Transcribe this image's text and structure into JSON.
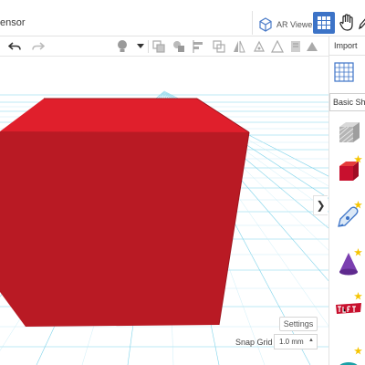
{
  "header": {
    "doc_title": "ensor",
    "ar_viewer_label": "AR Viewer"
  },
  "panel": {
    "import_label": "Import",
    "shapes_category": "Basic Shap"
  },
  "settings": {
    "settings_label": "Settings",
    "snap_grid_label": "Snap Grid",
    "snap_grid_value": "1.0 mm"
  },
  "colors": {
    "accent": "#3c73c7",
    "box_front": "#b91a24",
    "box_top": "#e01f2c",
    "box_side": "#cf1c28",
    "grid_line": "#7fd3ea"
  }
}
